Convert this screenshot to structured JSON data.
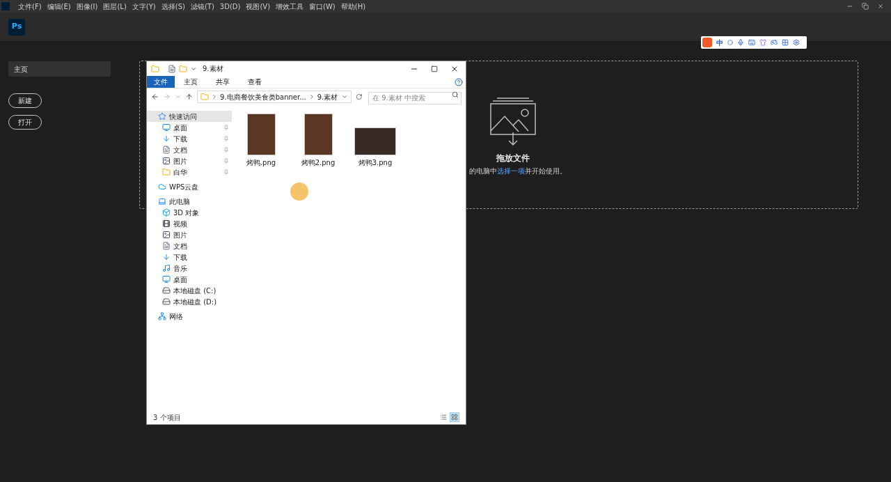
{
  "menu_bar": [
    "文件(F)",
    "编辑(E)",
    "图像(I)",
    "图层(L)",
    "文字(Y)",
    "选择(S)",
    "滤镜(T)",
    "3D(D)",
    "视图(V)",
    "增效工具",
    "窗口(W)",
    "帮助(H)"
  ],
  "app_logo": "Ps",
  "sidebar": {
    "items": [
      {
        "label": "主页",
        "selected": true
      }
    ],
    "buttons": [
      "新建",
      "打开"
    ]
  },
  "drop_zone": {
    "title": "拖放文件",
    "text_before": "的电脑中",
    "link": "选择一项",
    "text_after": "并开始使用。"
  },
  "ime_toolbar": {
    "mode": "中"
  },
  "explorer": {
    "title": "9.素材",
    "ribbon_tabs": [
      {
        "label": "文件",
        "selected": true
      },
      {
        "label": "主页",
        "selected": false
      },
      {
        "label": "共享",
        "selected": false
      },
      {
        "label": "查看",
        "selected": false
      }
    ],
    "breadcrumb": [
      "9.电商餐饮美食类banner...",
      "9.素材"
    ],
    "search": {
      "placeholder": "在 9.素材 中搜索"
    },
    "nav": [
      {
        "label": "快速访问",
        "kind": "star",
        "selected": true,
        "children": [
          {
            "label": "桌面",
            "kind": "desktop",
            "pinned": true
          },
          {
            "label": "下载",
            "kind": "download",
            "pinned": true
          },
          {
            "label": "文档",
            "kind": "document",
            "pinned": true
          },
          {
            "label": "图片",
            "kind": "picture",
            "pinned": true
          },
          {
            "label": "白华",
            "kind": "folder",
            "pinned": true
          }
        ]
      },
      {
        "label": "WPS云盘",
        "kind": "cloud",
        "selected": false
      },
      {
        "label": "此电脑",
        "kind": "computer",
        "selected": false,
        "children": [
          {
            "label": "3D 对象",
            "kind": "cube",
            "pinned": false
          },
          {
            "label": "视频",
            "kind": "video",
            "pinned": false
          },
          {
            "label": "图片",
            "kind": "picture",
            "pinned": false
          },
          {
            "label": "文档",
            "kind": "document",
            "pinned": false
          },
          {
            "label": "下载",
            "kind": "download",
            "pinned": false
          },
          {
            "label": "音乐",
            "kind": "music",
            "pinned": false
          },
          {
            "label": "桌面",
            "kind": "desktop",
            "pinned": false
          },
          {
            "label": "本地磁盘 (C:)",
            "kind": "drive",
            "pinned": false
          },
          {
            "label": "本地磁盘 (D:)",
            "kind": "drive",
            "pinned": false
          }
        ]
      },
      {
        "label": "网络",
        "kind": "network",
        "selected": false
      }
    ],
    "files": [
      {
        "name": "烤鸭.png",
        "kind": "portrait"
      },
      {
        "name": "烤鸭2.png",
        "kind": "portrait"
      },
      {
        "name": "烤鸭3.png",
        "kind": "landscape"
      }
    ],
    "status": "3 个项目",
    "views": [
      {
        "kind": "details",
        "selected": false
      },
      {
        "kind": "large",
        "selected": true
      }
    ]
  }
}
